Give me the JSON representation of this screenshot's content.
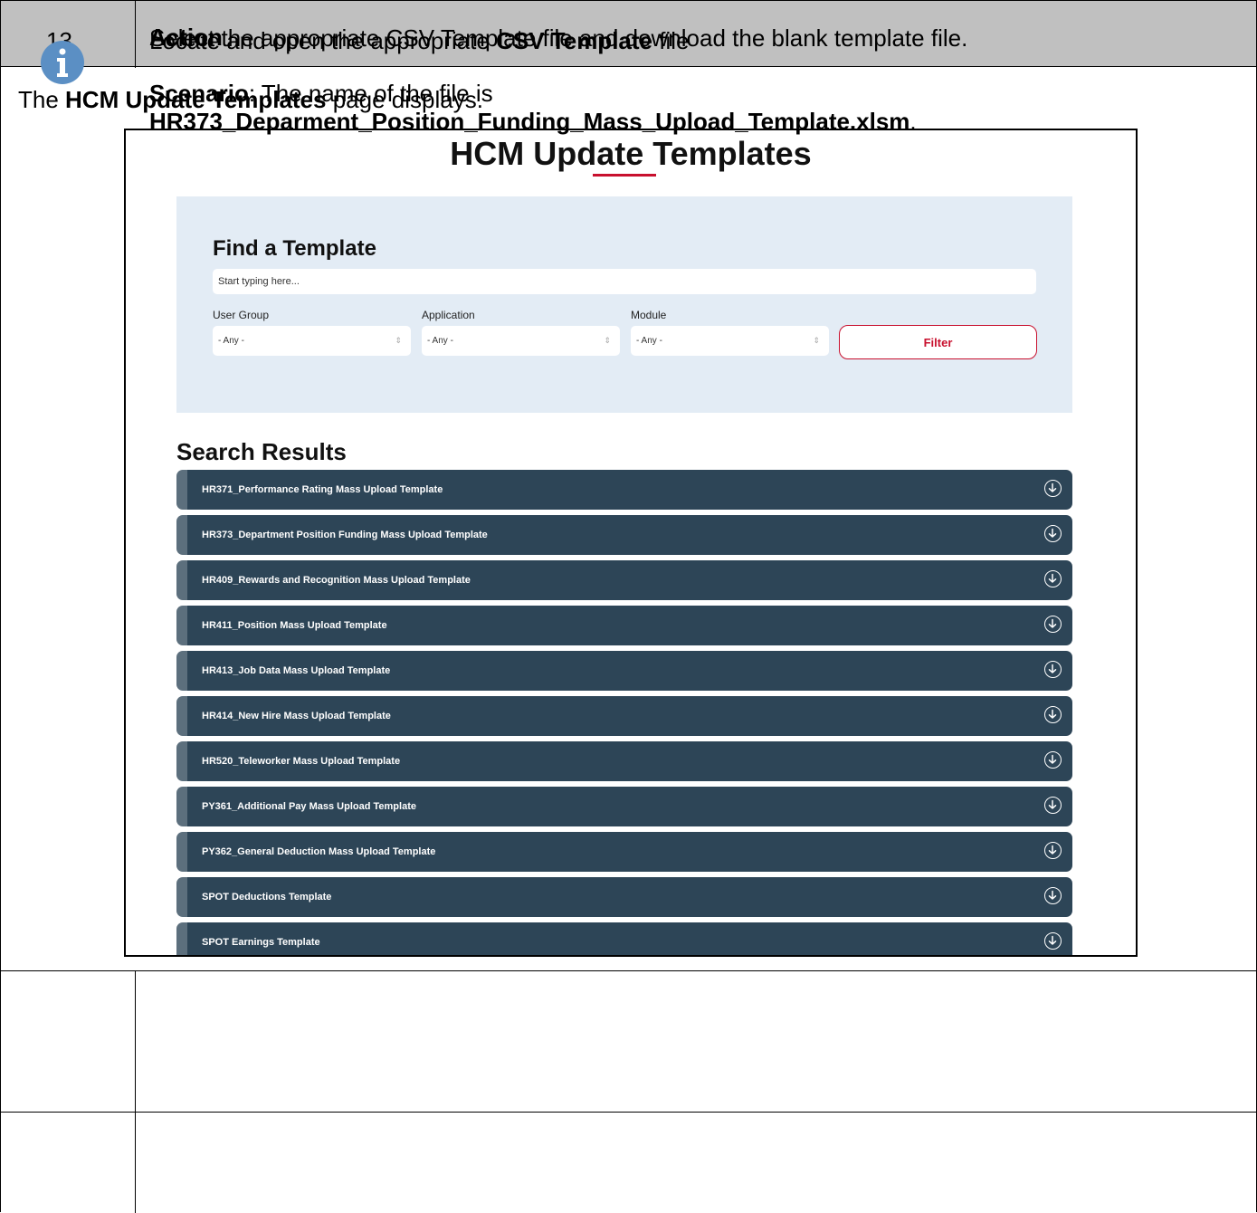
{
  "table_header": {
    "action_label": "Action"
  },
  "intro": {
    "prefix": "The ",
    "bold": "HCM Update Templates",
    "suffix": " page displays."
  },
  "screenshot": {
    "page_title": "HCM Update Templates",
    "find_title": "Find a Template",
    "search_placeholder": "Start typing here...",
    "filters": [
      {
        "label": "User Group",
        "value": "- Any -"
      },
      {
        "label": "Application",
        "value": "- Any -"
      },
      {
        "label": "Module",
        "value": "- Any -"
      }
    ],
    "filter_button": "Filter",
    "results_title": "Search Results",
    "results": [
      "HR371_Performance Rating Mass Upload Template",
      "HR373_Department Position Funding Mass Upload Template",
      "HR409_Rewards and Recognition Mass Upload Template",
      "HR411_Position Mass Upload Template",
      "HR413_Job Data Mass Upload Template",
      "HR414_New Hire Mass Upload Template",
      "HR520_Teleworker Mass Upload Template",
      "PY361_Additional Pay Mass Upload Template",
      "PY362_General Deduction Mass Upload Template",
      "SPOT Deductions Template",
      "SPOT Earnings Template"
    ],
    "accent_color": "#c8102e",
    "result_bar_color": "#2d4557"
  },
  "step": {
    "number": "13.",
    "line1_prefix": "Locate and open the appropriate ",
    "line1_bold": "CSV Template",
    "line1_suffix": " file",
    "scenario_label": "Scenario",
    "scenario_text": ": The name of the file is",
    "filename": "HR373_Deparment_Position_Funding_Mass_Upload_Template.xlsm",
    "filename_suffix": "."
  },
  "note": {
    "icon": "info-icon",
    "text": "Select the appropriate CSV Template file and download the blank template file."
  }
}
